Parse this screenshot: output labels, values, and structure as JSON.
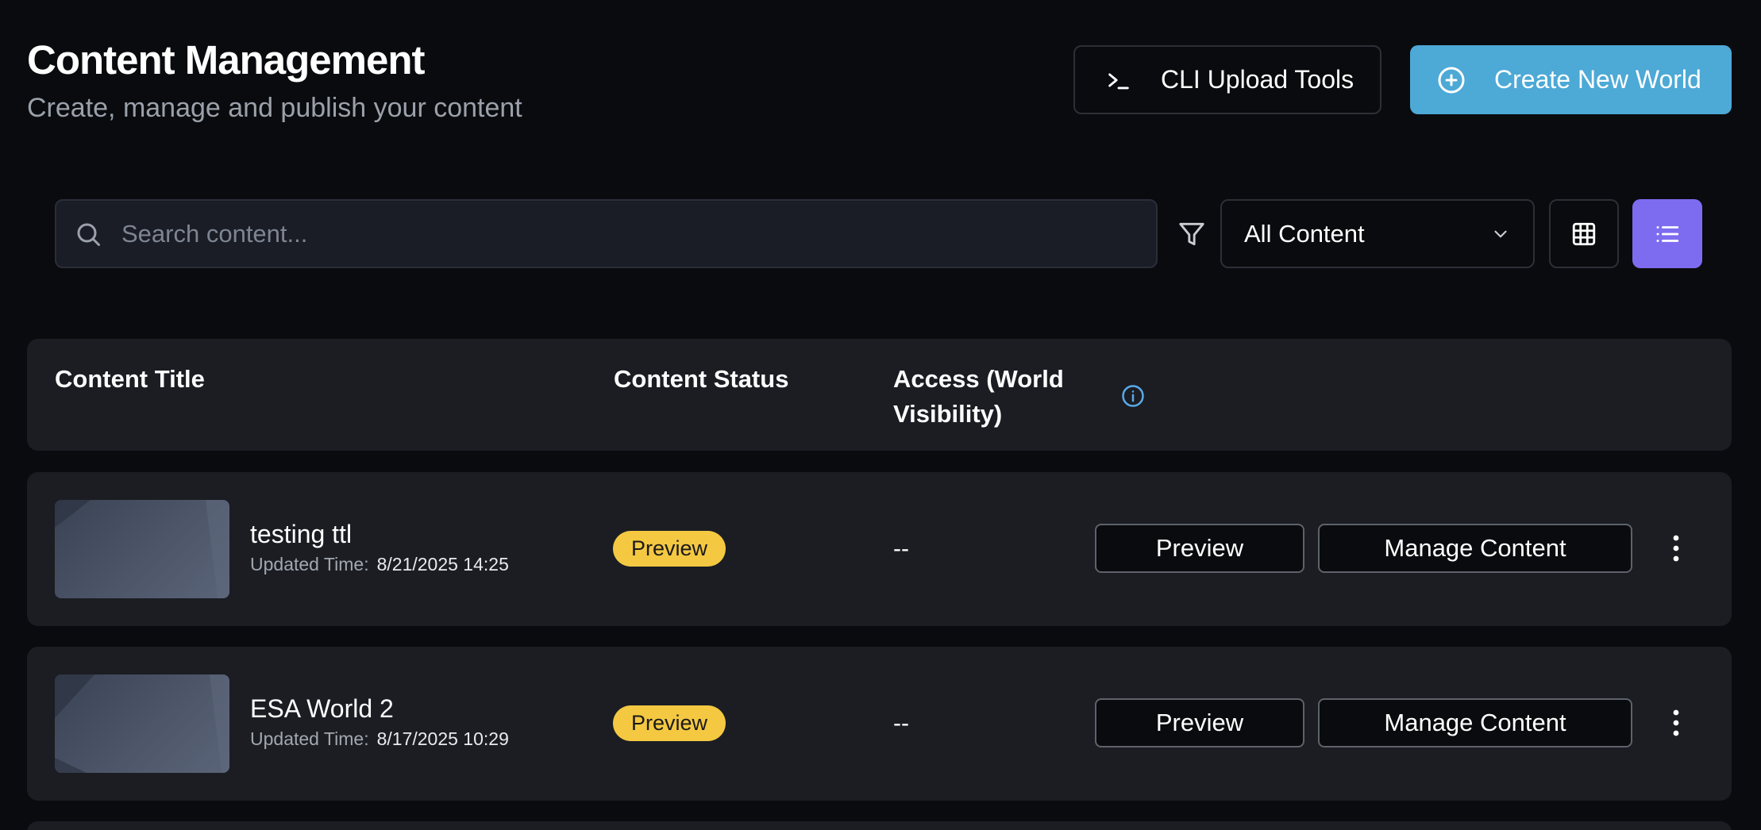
{
  "header": {
    "title": "Content Management",
    "subtitle": "Create, manage and publish your content",
    "cli_button_label": "CLI Upload Tools",
    "create_button_label": "Create New World"
  },
  "toolbar": {
    "search_placeholder": "Search content...",
    "filter_selected": "All Content"
  },
  "table": {
    "columns": {
      "title": "Content Title",
      "status": "Content Status",
      "access": "Access (World Visibility)"
    },
    "rows": [
      {
        "title": "testing ttl",
        "updated_label": "Updated Time:",
        "updated_value": "8/21/2025 14:25",
        "status": "Preview",
        "access": "--",
        "preview_label": "Preview",
        "manage_label": "Manage Content"
      },
      {
        "title": "ESA World 2",
        "updated_label": "Updated Time:",
        "updated_value": "8/17/2025 10:29",
        "status": "Preview",
        "access": "--",
        "preview_label": "Preview",
        "manage_label": "Manage Content"
      }
    ]
  },
  "colors": {
    "background": "#0a0b0e",
    "panel": "#1b1d23",
    "accent_blue": "#4da9d6",
    "accent_purple": "#7d6cf0",
    "badge_yellow": "#f5c842"
  },
  "icons": {
    "cli": "terminal-icon",
    "create": "plus-circle-icon",
    "search": "search-icon",
    "filter": "filter-icon",
    "select": "chevron-down-icon",
    "grid_view": "grid-icon",
    "list_view": "list-icon",
    "info": "info-icon",
    "more": "more-vertical-icon"
  }
}
